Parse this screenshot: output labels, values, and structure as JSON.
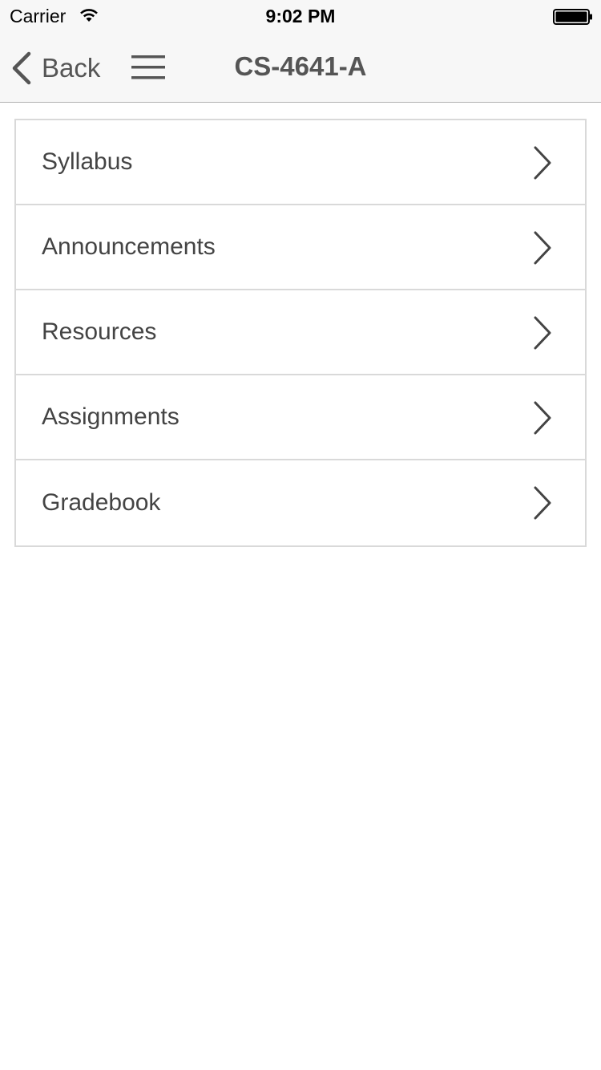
{
  "status_bar": {
    "carrier": "Carrier",
    "time": "9:02 PM"
  },
  "nav": {
    "back_label": "Back",
    "title": "CS-4641-A"
  },
  "menu": {
    "items": [
      {
        "label": "Syllabus"
      },
      {
        "label": "Announcements"
      },
      {
        "label": "Resources"
      },
      {
        "label": "Assignments"
      },
      {
        "label": "Gradebook"
      }
    ]
  },
  "colors": {
    "nav_background": "#f7f7f7",
    "text": "#444444",
    "border": "#d9d9d9"
  },
  "icons": {
    "wifi": "wifi-icon",
    "battery": "battery-icon",
    "back": "chevron-left-icon",
    "menu": "hamburger-menu-icon",
    "row": "chevron-right-icon"
  }
}
